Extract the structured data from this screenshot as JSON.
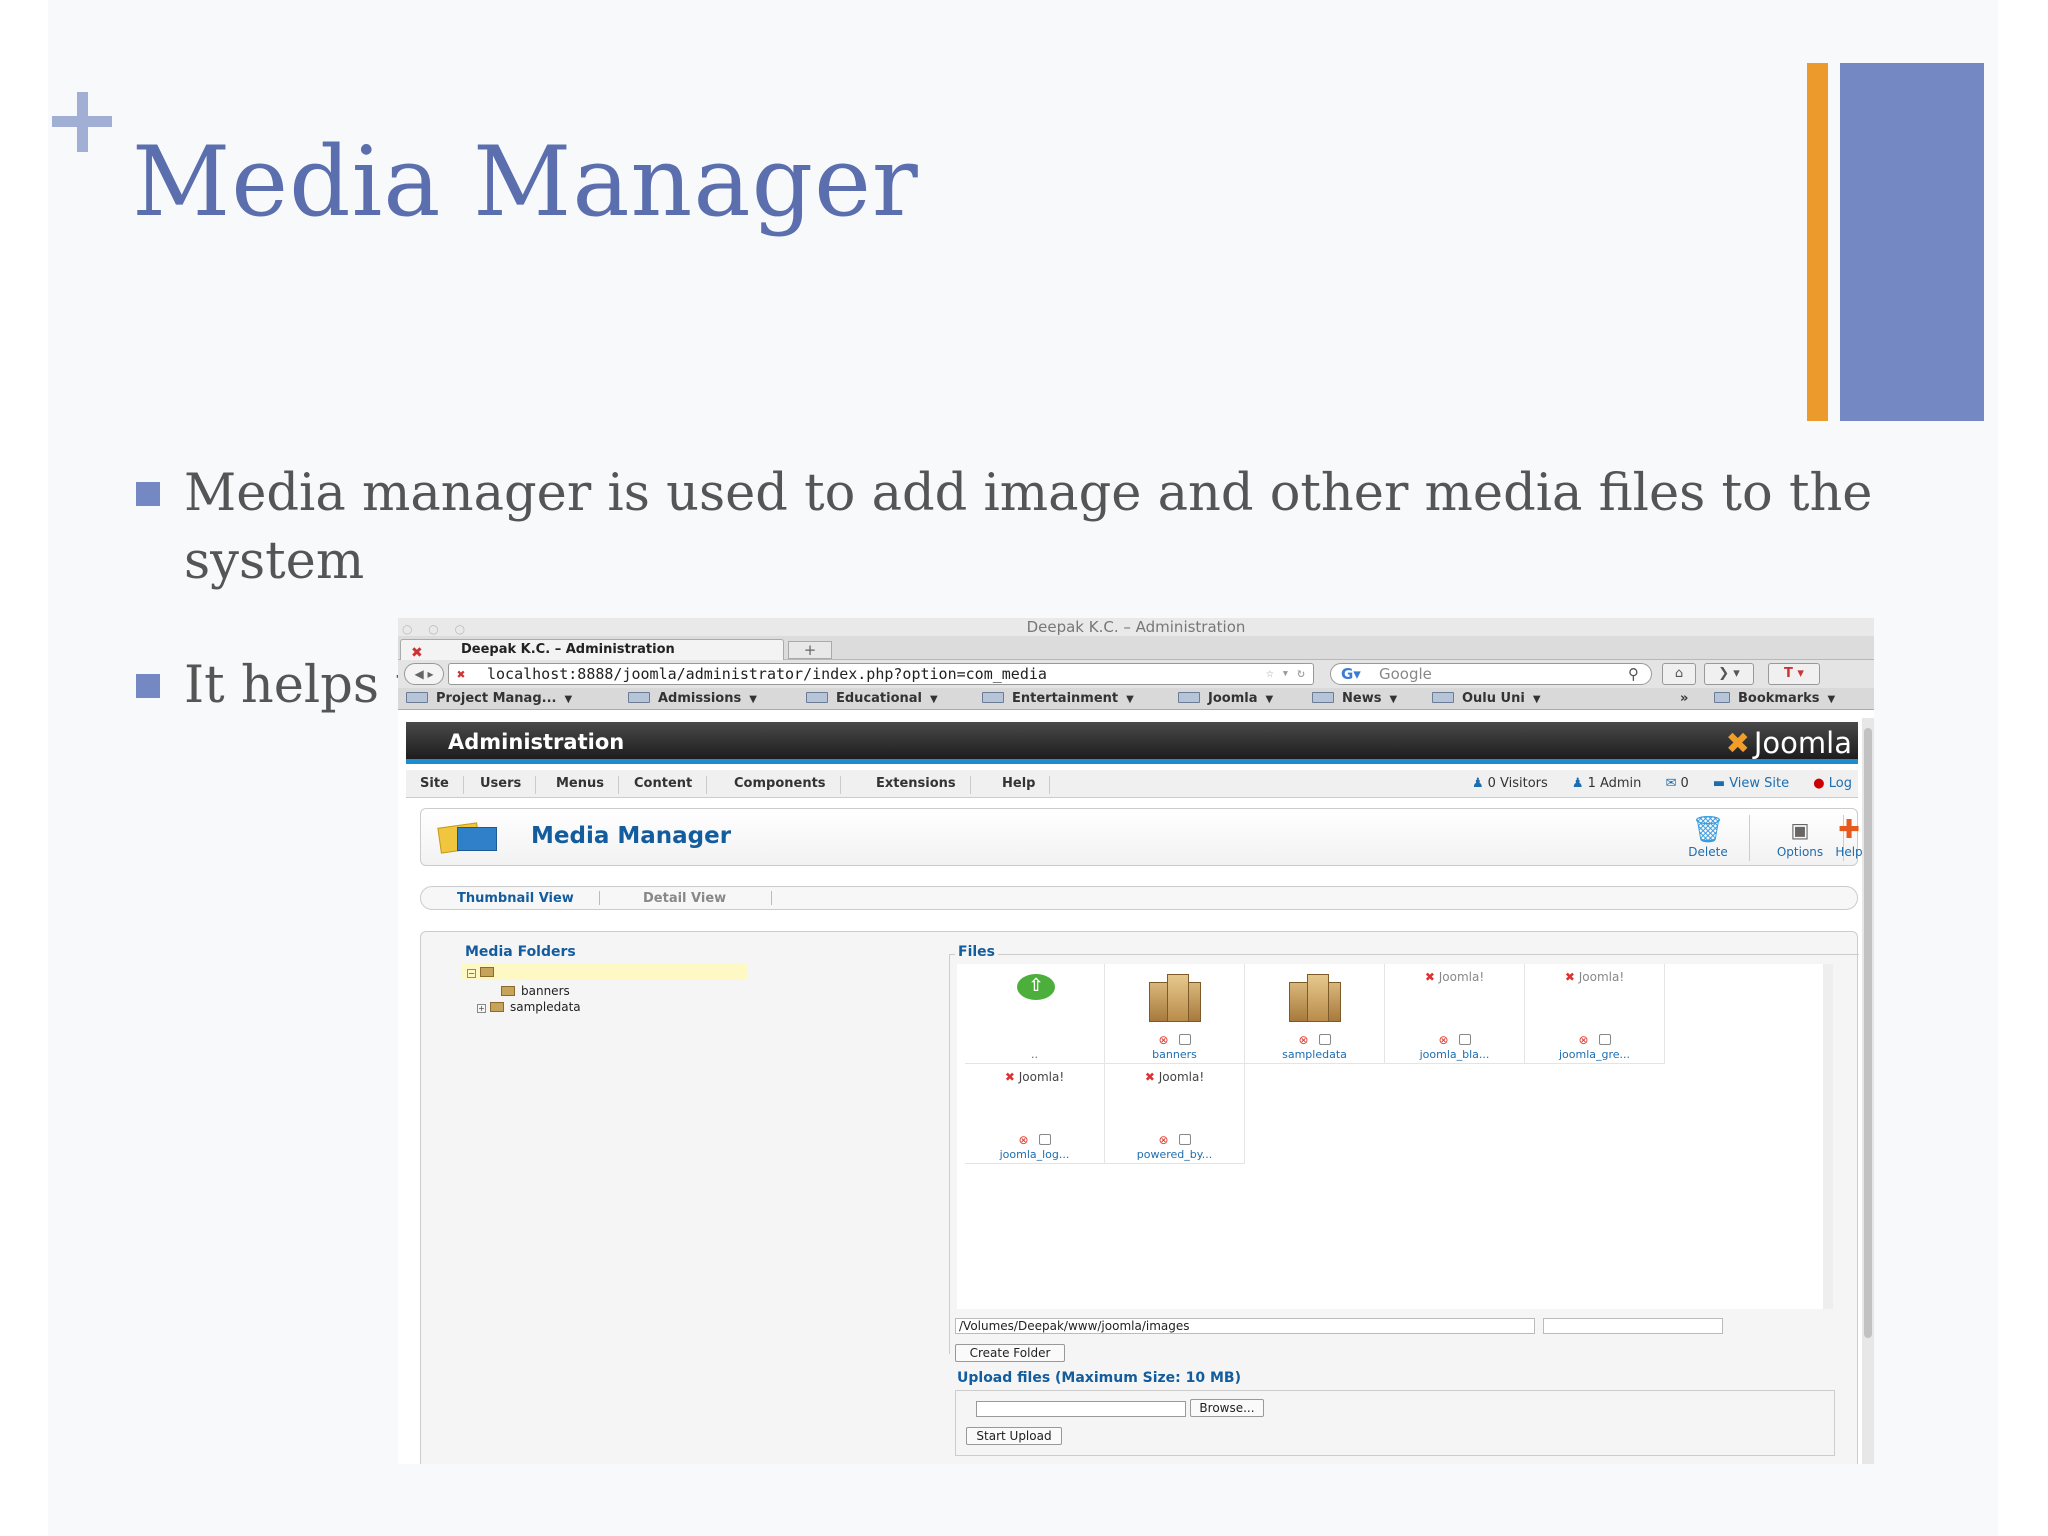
{
  "slide": {
    "title": "Media Manager",
    "bullets": [
      "Media manager is used to add image and other media files to the system",
      "It helps t"
    ],
    "colors": {
      "accent_blue": "#7489c4",
      "accent_orange": "#ec9a2b",
      "title": "#5b6fae"
    }
  },
  "browser": {
    "window_title": "Deepak K.C. – Administration",
    "tab_title": "Deepak K.C. – Administration",
    "new_tab": "+",
    "url": "localhost:8888/joomla/administrator/index.php?option=com_media",
    "search_placeholder": "Google",
    "bookmarks": [
      "Project Manag...",
      "Admissions",
      "Educational",
      "Entertainment",
      "Joomla",
      "News",
      "Oulu Uni"
    ],
    "bookmarks_overflow": "»",
    "bookmarks_menu": "Bookmarks"
  },
  "joomla": {
    "header_title": "Administration",
    "logo_text": "Joomla",
    "menu": [
      "Site",
      "Users",
      "Menus",
      "Content",
      "Components",
      "Extensions",
      "Help"
    ],
    "status": {
      "visitors": "0 Visitors",
      "admins": "1 Admin",
      "messages": "0",
      "view_site": "View Site",
      "logout": "Log"
    },
    "page_title": "Media Manager",
    "toolbar": {
      "delete": "Delete",
      "options": "Options",
      "help": "Help"
    },
    "views": {
      "thumbnail": "Thumbnail View",
      "detail": "Detail View"
    },
    "folders_title": "Media Folders",
    "folders": [
      "banners",
      "sampledata"
    ],
    "files_title": "Files",
    "files": [
      {
        "name": "..",
        "kind": "up"
      },
      {
        "name": "banners",
        "kind": "folder"
      },
      {
        "name": "sampledata",
        "kind": "folder"
      },
      {
        "name": "joomla_bla...",
        "kind": "image"
      },
      {
        "name": "joomla_gre...",
        "kind": "image"
      },
      {
        "name": "joomla_log...",
        "kind": "image"
      },
      {
        "name": "powered_by...",
        "kind": "image"
      }
    ],
    "path": "/Volumes/Deepak/www/joomla/images",
    "create_folder": "Create Folder",
    "upload_title": "Upload files (Maximum Size: 10 MB)",
    "browse": "Browse...",
    "start_upload": "Start Upload"
  }
}
